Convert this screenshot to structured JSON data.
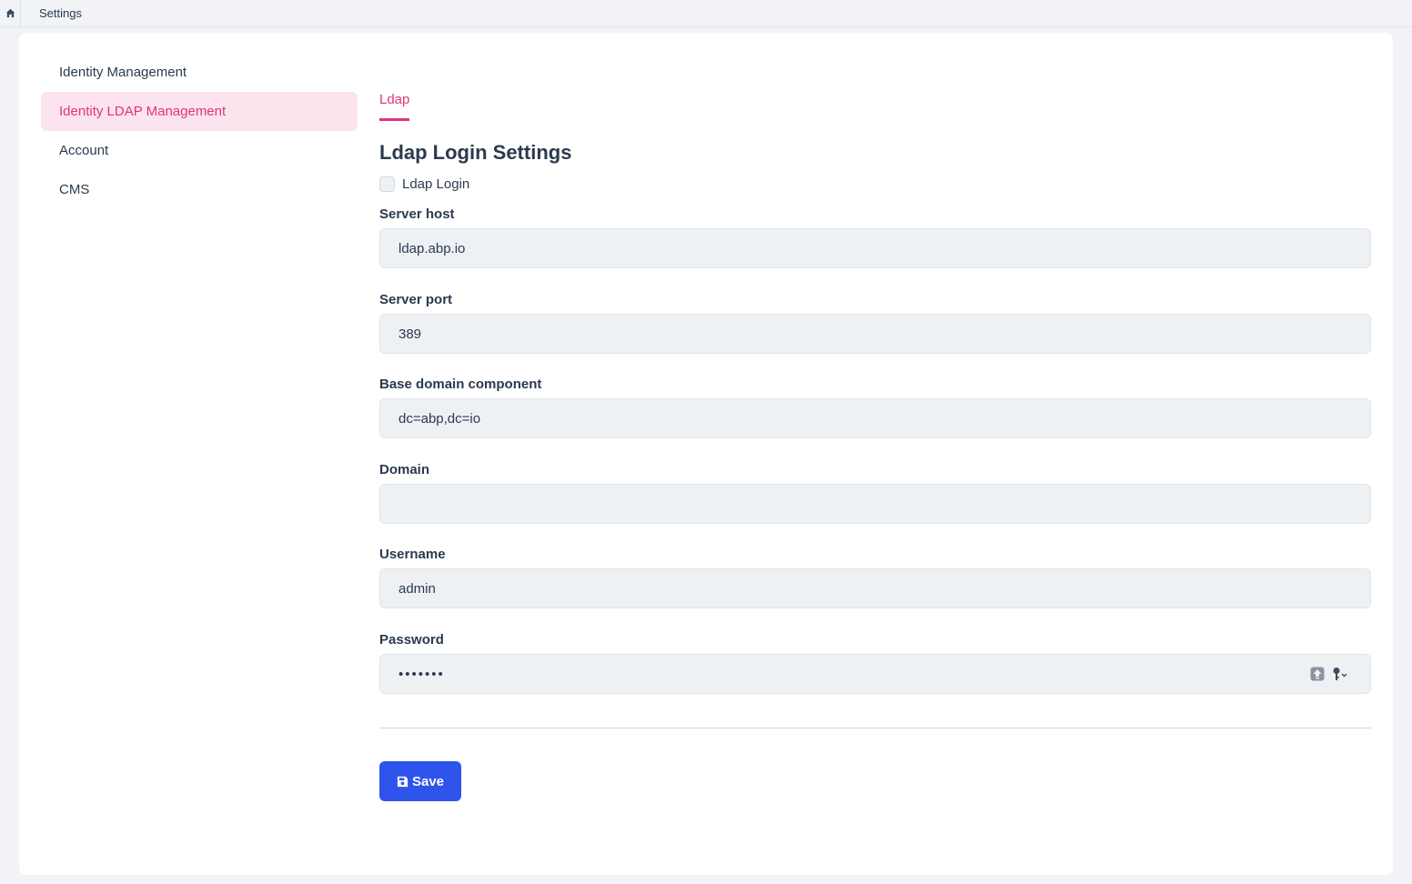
{
  "topbar": {
    "breadcrumb": "Settings"
  },
  "nav": {
    "items": [
      {
        "label": "Identity Management",
        "active": false
      },
      {
        "label": "Identity LDAP Management",
        "active": true
      },
      {
        "label": "Account",
        "active": false
      },
      {
        "label": "CMS",
        "active": false
      }
    ]
  },
  "tabs": [
    {
      "label": "Ldap",
      "active": true
    }
  ],
  "section_title": "Ldap Login Settings",
  "ldap_login": {
    "label": "Ldap Login",
    "checked": false
  },
  "fields": {
    "server_host": {
      "label": "Server host",
      "value": "ldap.abp.io"
    },
    "server_port": {
      "label": "Server port",
      "value": "389"
    },
    "base_dc": {
      "label": "Base domain component",
      "value": "dc=abp,dc=io"
    },
    "domain": {
      "label": "Domain",
      "value": ""
    },
    "username": {
      "label": "Username",
      "value": "admin"
    },
    "password": {
      "label": "Password",
      "value": "•••••••"
    }
  },
  "save_button": {
    "label": "Save"
  },
  "colors": {
    "accent": "#e1337c",
    "primary": "#2f54eb",
    "active_bg": "#fce4ee"
  }
}
